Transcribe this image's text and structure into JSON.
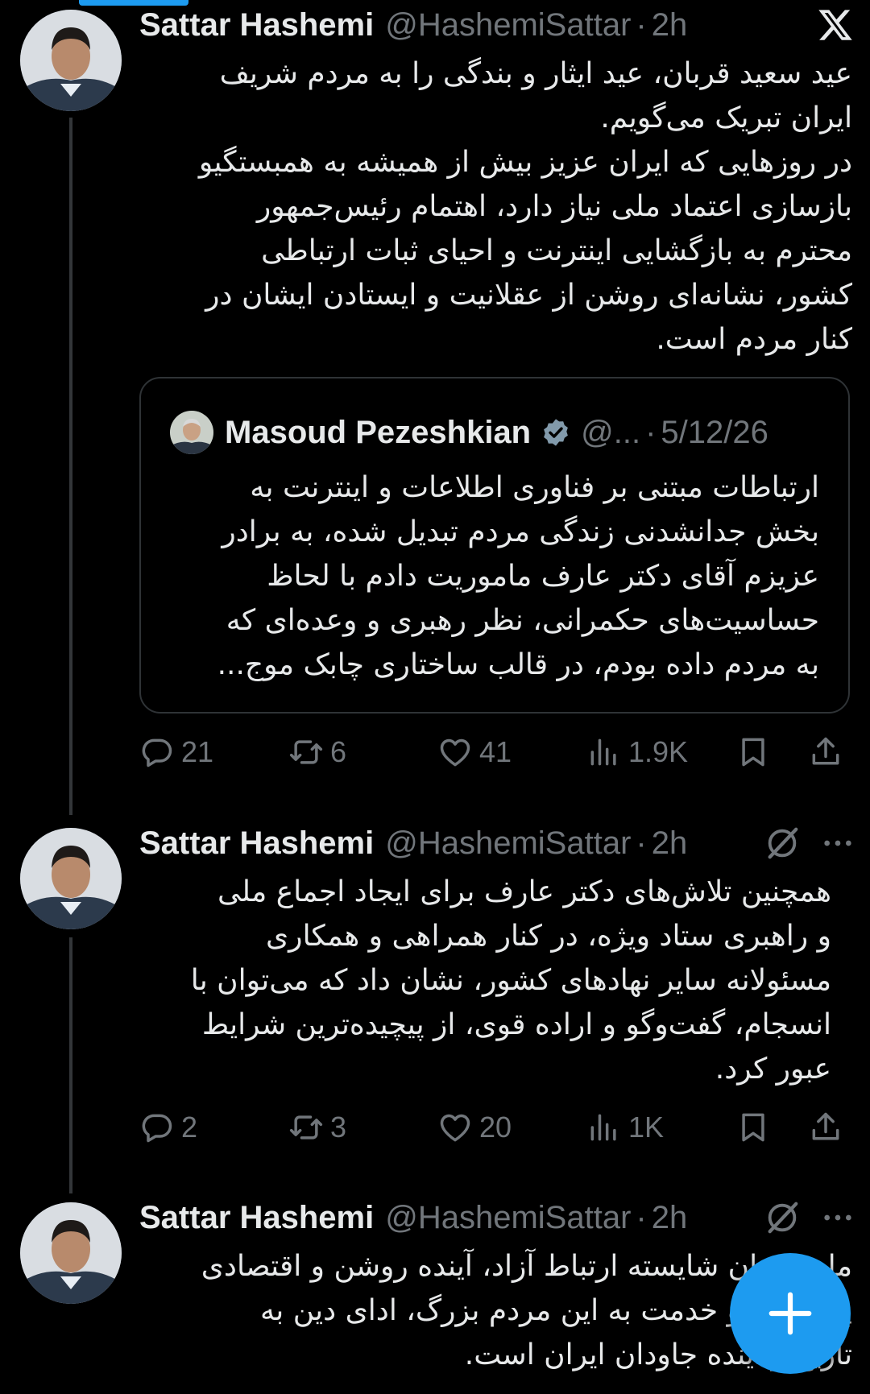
{
  "tweets": [
    {
      "name": "Sattar Hashemi",
      "handle": "@HashemiSattar",
      "dot": "·",
      "time": "2h",
      "text": "عید سعید قربان، عید ایثار و بندگی را به مردم شریف\nایران تبریک می‌گویم.\nدر روزهایی که ایران عزیز بیش از همیشه به همبستگیو\nبازسازی اعتماد ملی نیاز دارد، اهتمام رئیس‌جمهور\nمحترم به بازگشایی اینترنت و احیای ثبات ارتباطی\nکشور، نشانه‌ای روشن از عقلانیت و ایستادن ایشان در\nکنار مردم است.",
      "quote": {
        "name": "Masoud Pezeshkian",
        "handle": "@...",
        "dot": "·",
        "date": "5/12/26",
        "text": "ارتباطات مبتنی بر فناوری اطلاعات و اینترنت به\nبخش جدانشدنی زندگی مردم تبدیل شده، به برادر\nعزیزم آقای دکتر عارف ماموریت دادم با لحاظ\nحساسیت‌های حکمرانی، نظر رهبری و وعده‌ای که\nبه مردم داده بودم، در قالب ساختاری چابک موج..."
      },
      "replies": "21",
      "reposts": "6",
      "likes": "41",
      "views": "1.9K"
    },
    {
      "name": "Sattar Hashemi",
      "handle": "@HashemiSattar",
      "dot": "·",
      "time": "2h",
      "text": "همچنین تلاش‌های دکتر عارف برای ایجاد اجماع ملی\nو راهبری ستاد ویژه، در کنار همراهی و همکاری\nمسئولانه سایر نهادهای کشور، نشان داد که می‌توان با\nانسجام، گفت‌وگو و اراده قوی، از پیچیده‌ترین شرایط\nعبور کرد.",
      "replies": "2",
      "reposts": "3",
      "likes": "20",
      "views": "1K"
    },
    {
      "name": "Sattar Hashemi",
      "handle": "@HashemiSattar",
      "dot": "·",
      "time": "2h",
      "text": "ملت ایران شایسته ارتباط آزاد، آینده روشن و اقتصادی\nپویاست؛ و خدمت به این مردم بزرگ، ادای دین به\nتاریخ و آینده جاودان ایران است."
    }
  ],
  "colors": {
    "background": "#000000",
    "text": "#e7e9ea",
    "muted": "#71767b",
    "accent": "#1d9bf0",
    "border": "#2f3336"
  },
  "icons": {
    "logo": "x-logo-icon",
    "grok": "grok-icon",
    "more": "more-dots-icon",
    "reply": "reply-icon",
    "repost": "repost-icon",
    "like": "heart-icon",
    "views": "views-icon",
    "bookmark": "bookmark-icon",
    "share": "share-icon",
    "compose": "plus-icon"
  }
}
